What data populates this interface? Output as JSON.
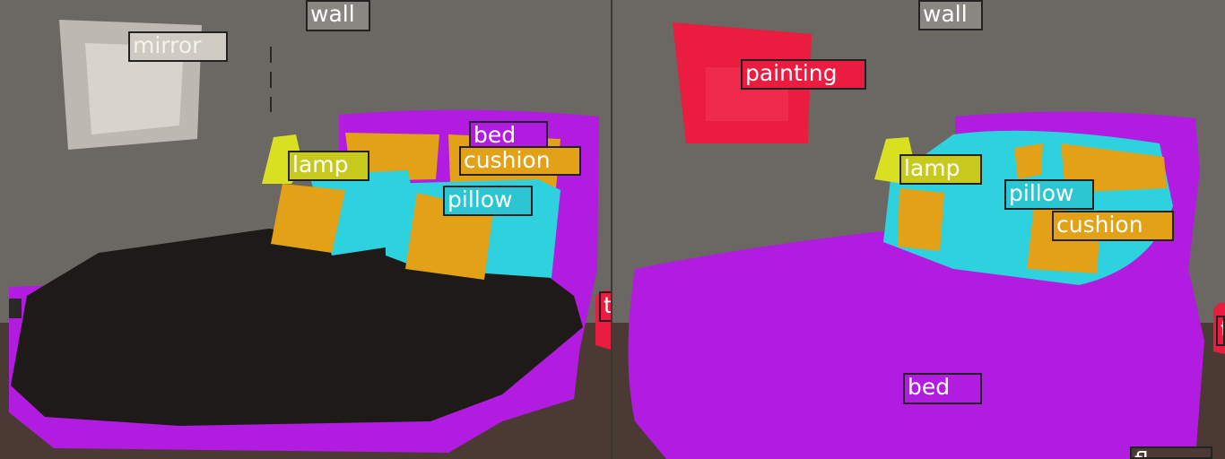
{
  "left_panel": {
    "labels": {
      "wall": "wall",
      "mirror": "mirror",
      "bed": "bed",
      "cushion": "cushion",
      "lamp": "lamp",
      "pillow": "pillow",
      "edge_partial": "t"
    }
  },
  "right_panel": {
    "labels": {
      "wall": "wall",
      "painting": "painting",
      "lamp": "lamp",
      "pillow": "pillow",
      "cushion": "cushion",
      "bed": "bed",
      "edge_partial": "t",
      "floor_partial": "fl"
    }
  },
  "colors": {
    "wall": "#6b6763",
    "floor": "#3d2e29",
    "bed": "#b21be0",
    "bedding_dark": "#1e1a17",
    "pillow": "#2dd2de",
    "cushion": "#e3a117",
    "lamp": "#d8e021",
    "painting": "#ea1c3f",
    "mirror": "#d8d3cb"
  }
}
